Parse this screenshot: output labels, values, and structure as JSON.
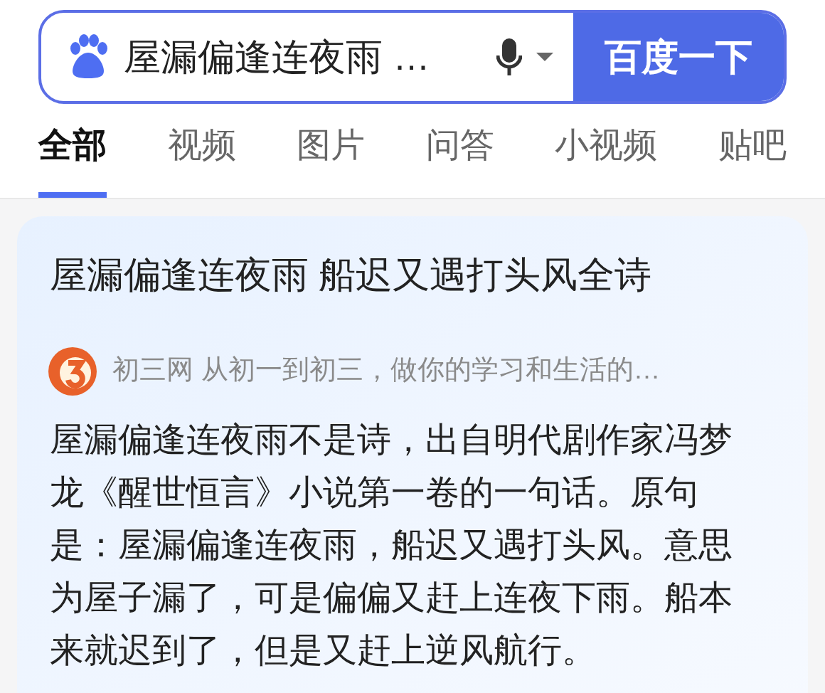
{
  "search": {
    "value": "屋漏偏逢连夜雨 …",
    "button": "百度一下"
  },
  "tabs": [
    {
      "label": "全部",
      "selected": true
    },
    {
      "label": "视频",
      "selected": false
    },
    {
      "label": "图片",
      "selected": false
    },
    {
      "label": "问答",
      "selected": false
    },
    {
      "label": "小视频",
      "selected": false
    },
    {
      "label": "贴吧",
      "selected": false
    }
  ],
  "result": {
    "title": "屋漏偏逢连夜雨 船迟又遇打头风全诗",
    "source": "初三网 从初一到初三，做你的学习和生活的…",
    "body": "屋漏偏逢连夜雨不是诗，出自明代剧作家冯梦龙《醒世恒言》小说第一卷的一句话。原句是：屋漏偏逢连夜雨，船迟又遇打头风。意思为屋子漏了，可是偏偏又赶上连夜下雨。船本来就迟到了，但是又赶上逆风航行。"
  }
}
